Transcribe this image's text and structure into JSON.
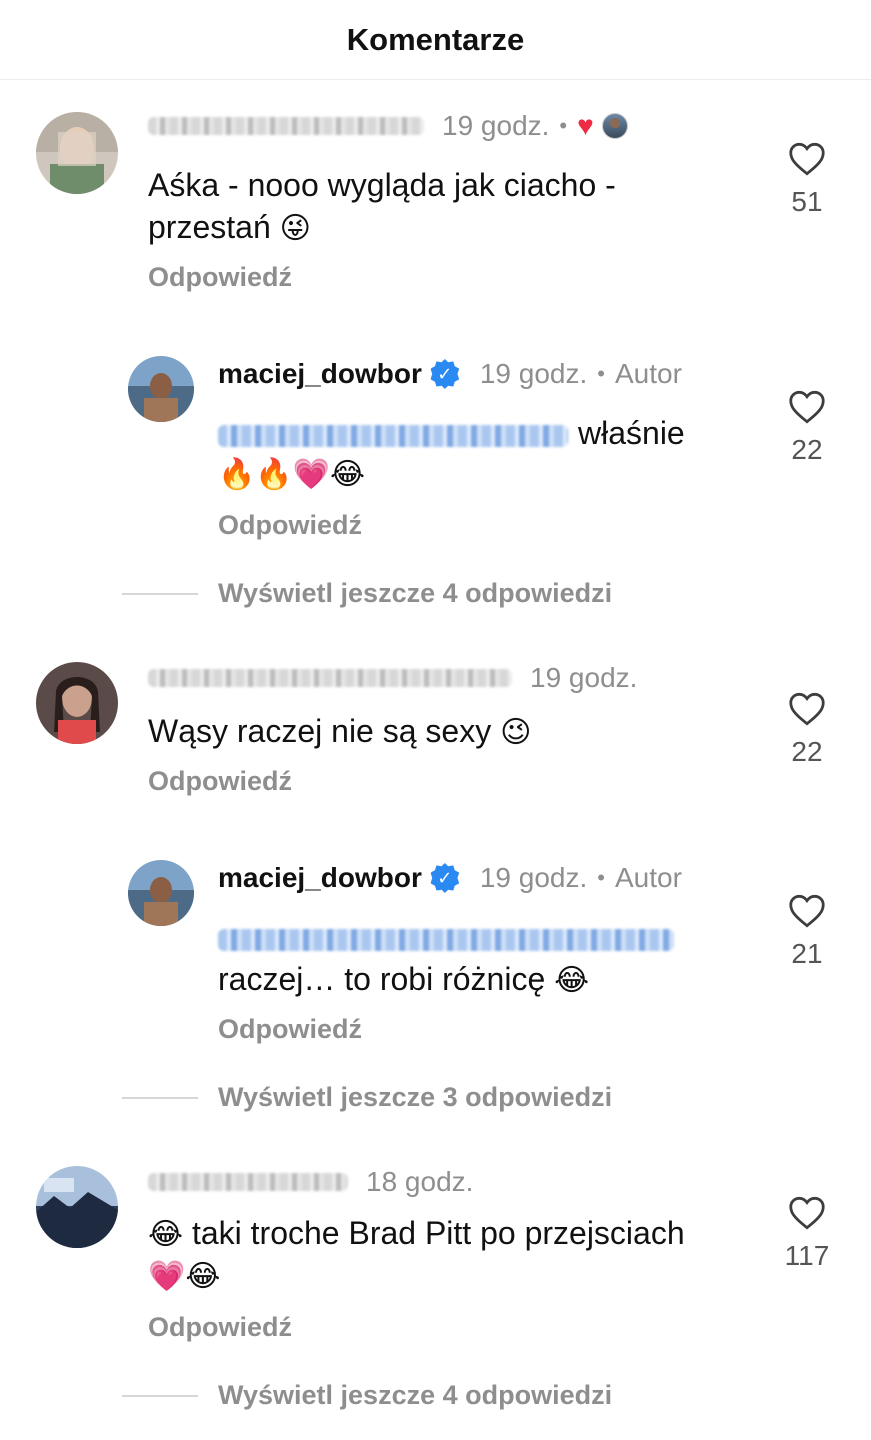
{
  "header": {
    "title": "Komentarze"
  },
  "comments": [
    {
      "time": "19 godz.",
      "text_line1": "Aśka - nooo wygląda jak ciacho -",
      "text_line2": "przestań",
      "emoji": "😜",
      "reply_label": "Odpowiedź",
      "likes": "51",
      "liked_by_author_icon": "heart-icon",
      "reply": {
        "username": "maciej_dowbor",
        "time": "19 godz.",
        "dot": "•",
        "author_label": "Autor",
        "text_after_mention": "właśnie",
        "emoji_line": "🔥🔥💗😂",
        "reply_label": "Odpowiedź",
        "likes": "22"
      },
      "view_more": "Wyświetl jeszcze 4 odpowiedzi"
    },
    {
      "time": "19 godz.",
      "text_line1": "Wąsy raczej nie są sexy",
      "emoji": "😉",
      "reply_label": "Odpowiedź",
      "likes": "22",
      "reply": {
        "username": "maciej_dowbor",
        "time": "19 godz.",
        "dot": "•",
        "author_label": "Autor",
        "text_line2": "raczej… to robi różnicę",
        "emoji": "😂",
        "reply_label": "Odpowiedź",
        "likes": "21"
      },
      "view_more": "Wyświetl jeszcze 3 odpowiedzi"
    },
    {
      "time": "18 godz.",
      "emoji_lead": "😂",
      "text_line1": "taki troche Brad Pitt po przejsciach",
      "emoji_line": "💗😂",
      "reply_label": "Odpowiedź",
      "likes": "117",
      "view_more": "Wyświetl jeszcze 4 odpowiedzi"
    }
  ],
  "colors": {
    "secondary_text": "#8e8e8e",
    "verified_blue": "#2b8af2",
    "heart_red": "#ed2b45",
    "mention_blue": "#a9c7ef"
  }
}
